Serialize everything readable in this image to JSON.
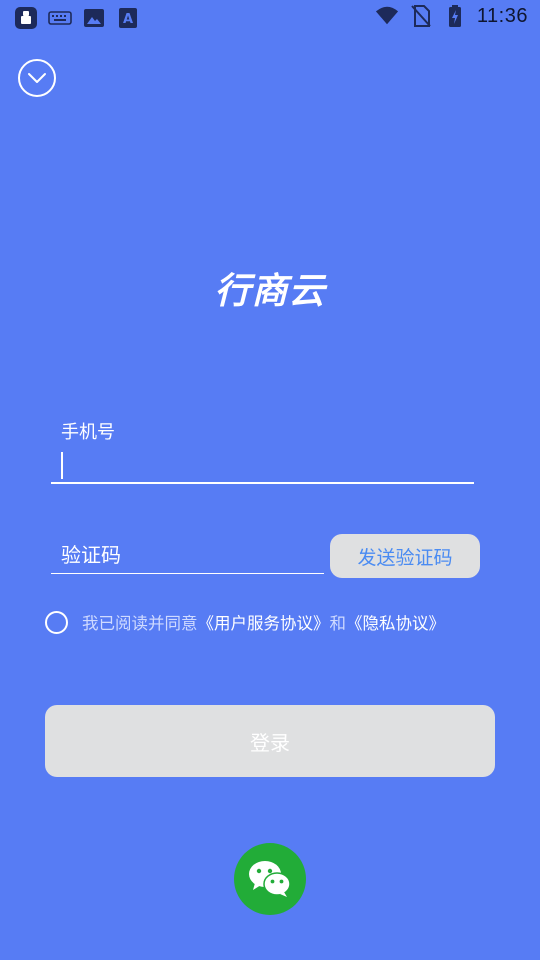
{
  "status_bar": {
    "time": "11:36",
    "icons_left": [
      "app-notification-icon",
      "keyboard-icon",
      "image-icon",
      "text-a-icon"
    ],
    "icons_right": [
      "wifi-icon",
      "no-sim-icon",
      "battery-charging-icon"
    ]
  },
  "header": {
    "collapse_icon": "chevron-down-circle-icon"
  },
  "logo": {
    "text": "行商云"
  },
  "form": {
    "phone_label": "手机号",
    "phone_value": "",
    "code_placeholder": "验证码",
    "code_value": "",
    "send_code_label": "发送验证码"
  },
  "agreement": {
    "prefix": "我已阅读并同意",
    "user_agreement": "《用户服务协议》",
    "conjunction": "和",
    "privacy_agreement": "《隐私协议》"
  },
  "login": {
    "label": "登录"
  },
  "social": {
    "wechat_icon": "wechat-icon"
  },
  "colors": {
    "background": "#577cf4",
    "button_disabled": "#dfe0e1",
    "send_code_text": "#4a8bf2",
    "wechat": "#22ac38"
  }
}
